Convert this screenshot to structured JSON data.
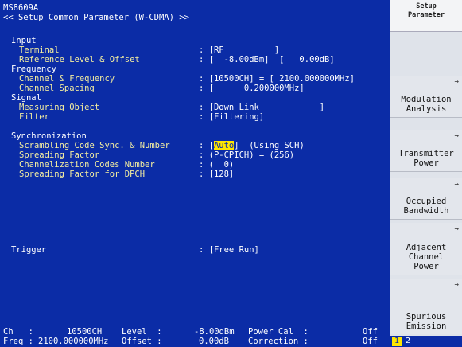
{
  "model": "MS8609A",
  "screen_title": "<< Setup Common Parameter (W-CDMA) >>",
  "sections": {
    "input": "Input",
    "frequency": "Frequency",
    "signal": "Signal",
    "synchronization": "Synchronization",
    "trigger": "Trigger"
  },
  "params": {
    "terminal": {
      "label": "Terminal",
      "value": ": [RF          ]"
    },
    "ref_level": {
      "label": "Reference Level & Offset",
      "value": ": [  -8.00dBm]  [   0.00dB]"
    },
    "channel_freq": {
      "label": "Channel & Frequency",
      "value": ": [10500CH] = [ 2100.000000MHz]"
    },
    "channel_spacing": {
      "label": "Channel Spacing",
      "value": ": [      0.200000MHz]"
    },
    "measuring_object": {
      "label": "Measuring Object",
      "value": ": [Down Link            ]"
    },
    "filter": {
      "label": "Filter",
      "value": ": [Filtering]"
    },
    "scrambling": {
      "label": "Scrambling Code Sync. & Number",
      "value_prefix": ": [",
      "value_hl": "Auto",
      "value_suffix": "]  (Using SCH)"
    },
    "spreading": {
      "label": "Spreading Factor",
      "value": ": (P-CPICH) = (256)"
    },
    "channelization": {
      "label": "Channelization Codes Number",
      "value": ": (  0)"
    },
    "spreading_dpch": {
      "label": "Spreading Factor for DPCH",
      "value": ": [128]"
    },
    "trigger": {
      "label": "Trigger",
      "value": ": [Free Run]"
    }
  },
  "status": {
    "ch_label": "Ch   :",
    "ch_value": "10500CH",
    "level_label": "Level  :",
    "level_value": "-8.00dBm",
    "power_cal_label": "Power Cal  :",
    "power_cal_value": "Off",
    "freq_label": "Freq :",
    "freq_value": "2100.000000MHz",
    "offset_label": "Offset :",
    "offset_value": "0.00dB",
    "correction_label": "Correction :",
    "correction_value": "Off"
  },
  "sidebar": {
    "title_line1": "Setup",
    "title_line2": "Parameter",
    "softkeys": [
      {
        "line1": "Modulation",
        "line2": "Analysis",
        "line3": "",
        "arrow": "→"
      },
      {
        "line1": "Transmitter",
        "line2": "Power",
        "line3": "",
        "arrow": "→"
      },
      {
        "line1": "Occupied",
        "line2": "Bandwidth",
        "line3": "",
        "arrow": "→"
      },
      {
        "line1": "Adjacent",
        "line2": "Channel",
        "line3": "Power",
        "arrow": "→"
      },
      {
        "line1": "Spurious",
        "line2": "Emission",
        "line3": "",
        "arrow": "→"
      }
    ],
    "page1": "1",
    "page2": "2"
  }
}
